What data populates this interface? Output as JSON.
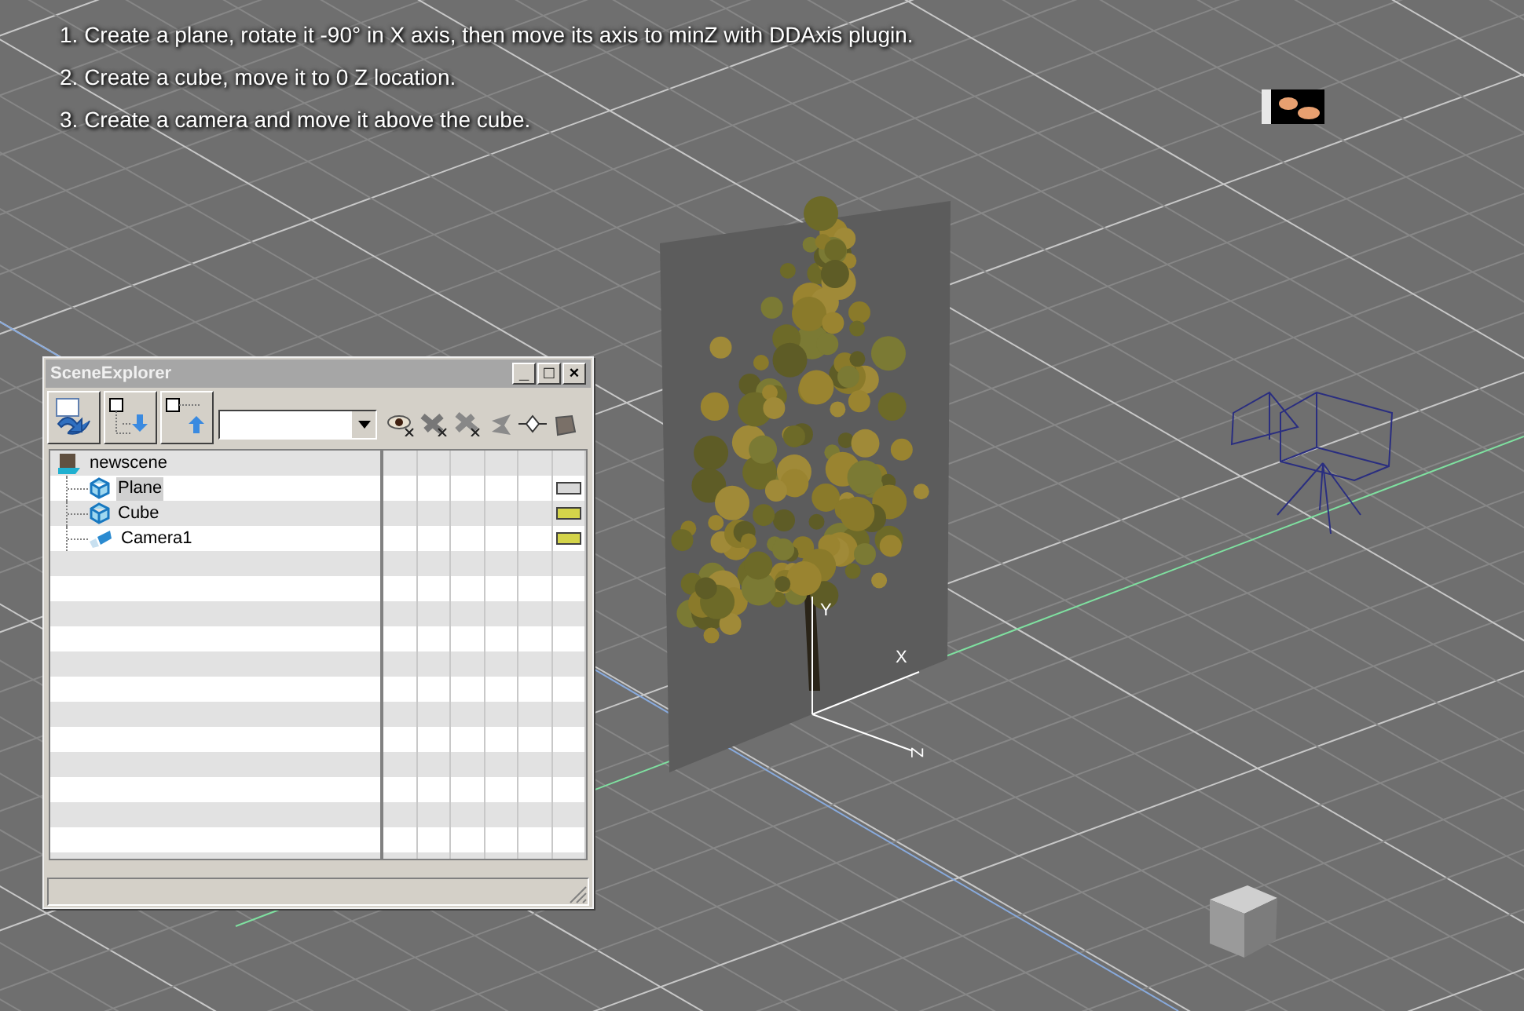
{
  "instructions": [
    "1. Create a plane, rotate it -90° in X axis, then move its axis to minZ with DDAxis plugin.",
    "2. Create a cube, move it to 0 Z location.",
    "3. Create a camera and move it above the cube."
  ],
  "viewport": {
    "axis_labels": [
      "Y",
      "X",
      "Z"
    ]
  },
  "scene_explorer": {
    "title": "SceneExplorer",
    "window_buttons": [
      "_",
      "□",
      "×"
    ],
    "tree": {
      "label": "newscene",
      "kind": "scene",
      "selected": false,
      "children": [
        {
          "label": "Plane",
          "kind": "mesh",
          "selected": true,
          "color": "#d8d8d8"
        },
        {
          "label": "Cube",
          "kind": "mesh",
          "selected": false,
          "color": "#d4d44a"
        },
        {
          "label": "Camera1",
          "kind": "camera",
          "selected": false,
          "color": "#d4d44a"
        }
      ]
    }
  }
}
